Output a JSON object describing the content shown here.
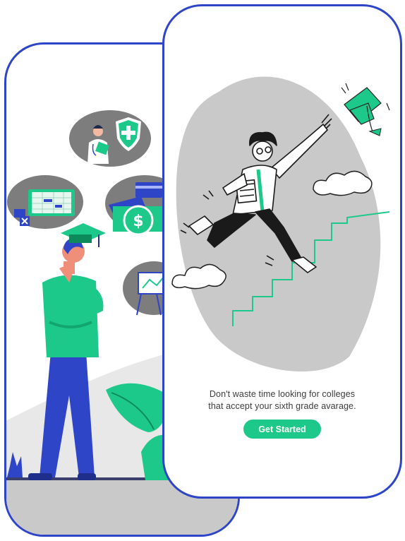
{
  "onboarding": {
    "tagline_line1": "Don't waste time looking for colleges",
    "tagline_line2": "that accept your sixth grade avarage.",
    "cta_label": "Get Started"
  },
  "colors": {
    "frame": "#2f45c8",
    "accent": "#1cc98a",
    "blob": "#c9c9c9",
    "text": "#3b3b3b"
  },
  "icons": [
    "graduate-student-illustration",
    "doctor-icon",
    "health-shield-icon",
    "spreadsheet-icon",
    "money-dollar-icon",
    "credit-card-icon",
    "presentation-board-icon",
    "plant-leaf-icon",
    "running-student-illustration",
    "graduation-cap-icon",
    "stairs-icon",
    "cloud-icon"
  ]
}
